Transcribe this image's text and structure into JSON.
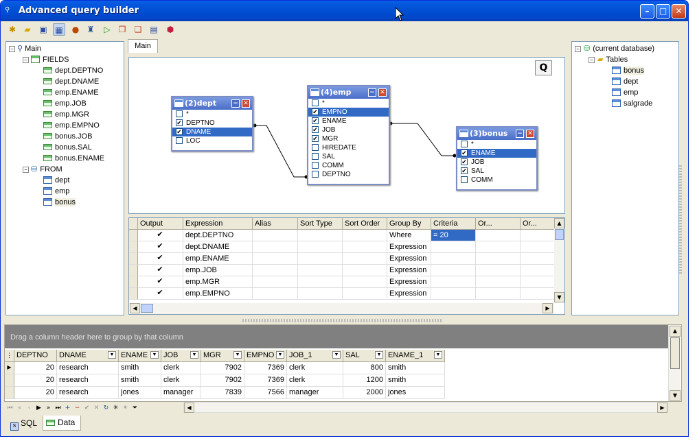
{
  "window": {
    "title": "Advanced query builder"
  },
  "toolbar": {
    "icons": [
      "new-icon",
      "open-icon",
      "save-icon",
      "layout-icon",
      "database-icon",
      "schema-icon",
      "run-icon",
      "copy-icon",
      "paste-icon",
      "export-icon",
      "package-icon"
    ]
  },
  "tree": {
    "root": "Main",
    "fields_label": "FIELDS",
    "fields": [
      "dept.DEPTNO",
      "dept.DNAME",
      "emp.ENAME",
      "emp.JOB",
      "emp.MGR",
      "emp.EMPNO",
      "bonus.JOB",
      "bonus.SAL",
      "bonus.ENAME"
    ],
    "from_label": "FROM",
    "from": [
      "dept",
      "emp",
      "bonus"
    ]
  },
  "tab_main": "Main",
  "q_button": "Q",
  "tables": {
    "dept": {
      "title": "(2)dept",
      "rows": [
        {
          "n": "*",
          "c": false
        },
        {
          "n": "DEPTNO",
          "c": true
        },
        {
          "n": "DNAME",
          "c": true,
          "s": true
        },
        {
          "n": "LOC",
          "c": false
        }
      ]
    },
    "emp": {
      "title": "(4)emp",
      "rows": [
        {
          "n": "*",
          "c": false
        },
        {
          "n": "EMPNO",
          "c": true,
          "s": true
        },
        {
          "n": "ENAME",
          "c": true
        },
        {
          "n": "JOB",
          "c": true
        },
        {
          "n": "MGR",
          "c": true
        },
        {
          "n": "HIREDATE",
          "c": false
        },
        {
          "n": "SAL",
          "c": false
        },
        {
          "n": "COMM",
          "c": false
        },
        {
          "n": "DEPTNO",
          "c": false
        }
      ]
    },
    "bonus": {
      "title": "(3)bonus",
      "rows": [
        {
          "n": "*",
          "c": false
        },
        {
          "n": "ENAME",
          "c": true,
          "s": true
        },
        {
          "n": "JOB",
          "c": true
        },
        {
          "n": "SAL",
          "c": true
        },
        {
          "n": "COMM",
          "c": false
        }
      ]
    }
  },
  "qgrid": {
    "headers": [
      "Output",
      "Expression",
      "Alias",
      "Sort Type",
      "Sort Order",
      "Group By",
      "Criteria",
      "Or...",
      "Or..."
    ],
    "rows": [
      {
        "expr": "dept.DEPTNO",
        "group": "Where",
        "crit": "= 20"
      },
      {
        "expr": "dept.DNAME",
        "group": "Expression",
        "crit": ""
      },
      {
        "expr": "emp.ENAME",
        "group": "Expression",
        "crit": ""
      },
      {
        "expr": "emp.JOB",
        "group": "Expression",
        "crit": ""
      },
      {
        "expr": "emp.MGR",
        "group": "Expression",
        "crit": ""
      },
      {
        "expr": "emp.EMPNO",
        "group": "Expression",
        "crit": ""
      }
    ]
  },
  "dbtree": {
    "db": "(current database)",
    "tables_label": "Tables",
    "tables": [
      "bonus",
      "dept",
      "emp",
      "salgrade"
    ]
  },
  "results": {
    "group_hint": "Drag a column header here to group by that column",
    "headers": [
      "DEPTNO",
      "DNAME",
      "ENAME",
      "JOB",
      "MGR",
      "EMPNO",
      "JOB_1",
      "SAL",
      "ENAME_1"
    ],
    "rows": [
      [
        "20",
        "research",
        "smith",
        "clerk",
        "7902",
        "7369",
        "clerk",
        "800",
        "smith"
      ],
      [
        "20",
        "research",
        "smith",
        "clerk",
        "7902",
        "7369",
        "clerk",
        "1200",
        "smith"
      ],
      [
        "20",
        "research",
        "jones",
        "manager",
        "7839",
        "7566",
        "manager",
        "2000",
        "jones"
      ]
    ]
  },
  "navigator": {
    "buttons": [
      "first-icon",
      "prev-page-icon",
      "prev-icon",
      "next-icon",
      "next-page-icon",
      "last-icon",
      "insert-icon",
      "delete-icon",
      "post-icon",
      "cancel-icon",
      "refresh-icon",
      "bookmark-icon",
      "goto-bookmark-icon",
      "filter-icon"
    ]
  },
  "bottom_tabs": [
    "SQL",
    "Data"
  ]
}
